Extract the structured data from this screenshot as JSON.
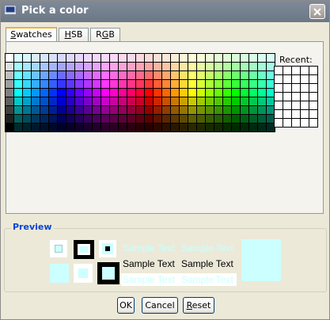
{
  "window": {
    "title": "Pick a color"
  },
  "tabs": [
    {
      "label": "Swatches",
      "mnemonic": "S",
      "rest": "watches"
    },
    {
      "label": "HSB",
      "mnemonic": "H",
      "rest": "SB"
    },
    {
      "label": "RGB",
      "mnemonic": "G",
      "pre": "R",
      "rest": "B"
    }
  ],
  "swatches": {
    "recent_label": "Recent:"
  },
  "preview": {
    "legend": "Preview",
    "sample_text": "Sample Text",
    "selected_color": "#ccffff"
  },
  "buttons": {
    "ok": "OK",
    "cancel": "Cancel",
    "reset": "Reset",
    "reset_mnemonic": "R",
    "reset_rest": "eset"
  },
  "colors": {
    "tab_highlight": "#f2b134",
    "legend": "#0046d5",
    "preview": "#ccffff"
  }
}
